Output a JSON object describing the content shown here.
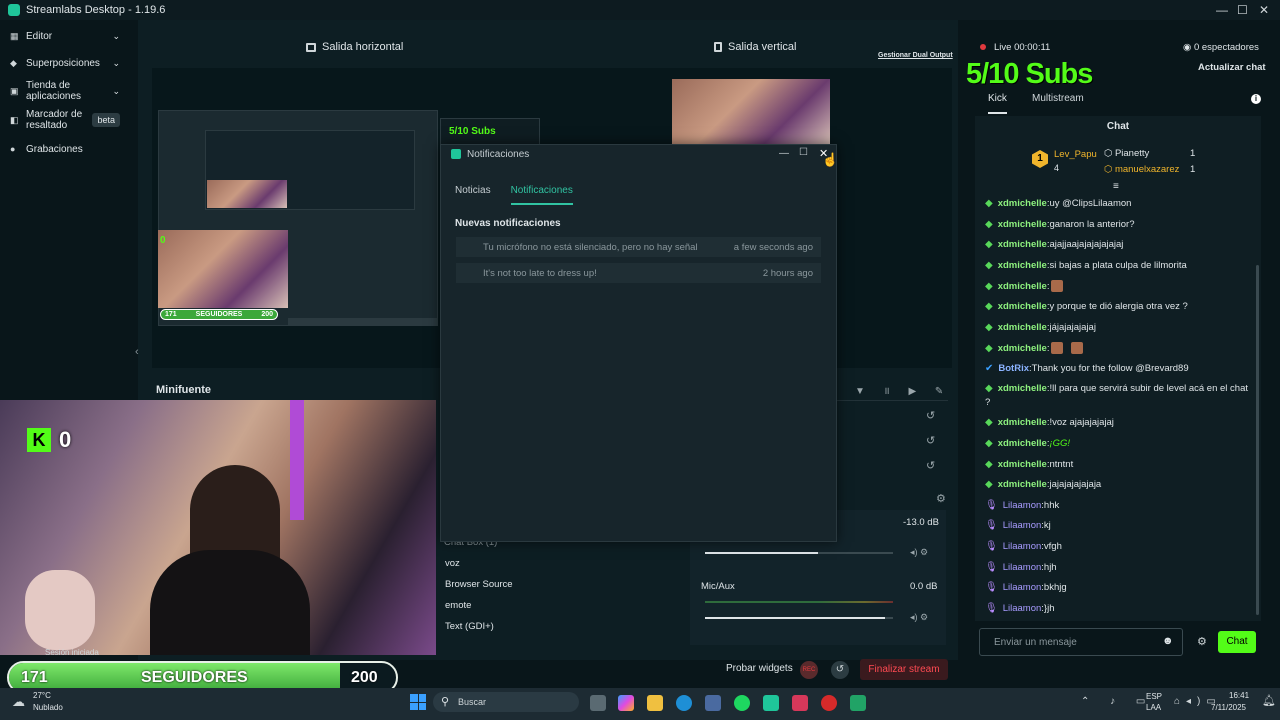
{
  "app": {
    "title": "Streamlabs Desktop - 1.19.6"
  },
  "sidebar": {
    "items": [
      {
        "label": "Editor",
        "icon": "layout-icon",
        "chevron": "chevron-down-icon"
      },
      {
        "label": "Superposiciones",
        "icon": "palette-icon",
        "chevron": "chevron-down-icon"
      },
      {
        "label": "Tienda de aplicaciones",
        "icon": "store-icon",
        "chevron": "chevron-down-icon"
      },
      {
        "label": "Marcador de resaltado",
        "icon": "bookmark-icon",
        "badge": "beta"
      },
      {
        "label": "Grabaciones",
        "icon": "record-icon"
      }
    ]
  },
  "outputs": {
    "horizontal": "Salida horizontal",
    "vertical": "Salida vertical",
    "manage": "Gestionar Dual Output"
  },
  "preview": {
    "inner_subs": "5/10 Subs",
    "inner_kick": "0",
    "inner_follow_left": "171",
    "inner_follow_mid": "SEGUIDORES",
    "inner_follow_right": "200"
  },
  "notifications": {
    "window_title": "Notificaciones",
    "tabs": [
      {
        "label": "Noticias",
        "active": false
      },
      {
        "label": "Notificaciones",
        "active": true
      }
    ],
    "section": "Nuevas notificaciones",
    "items": [
      {
        "text": "Tu micrófono no está silenciado, pero no hay señal",
        "time": "a few seconds ago"
      },
      {
        "text": "It's not too late to dress up!",
        "time": "2 hours ago"
      }
    ]
  },
  "sources": {
    "title": "Minifuente",
    "items": [
      "Chat Box (1)",
      "voz",
      "Browser Source",
      "emote",
      "Text (GDI+)"
    ]
  },
  "mixer": {
    "channels": [
      {
        "name": "",
        "db": "-13.0 dB",
        "level": 0.6
      },
      {
        "name": "Mic/Aux",
        "db": "0.0 dB",
        "level": 0.96
      }
    ]
  },
  "overlay": {
    "kick_count": "0",
    "follow_current": "171",
    "follow_label": "SEGUIDORES",
    "follow_goal": "200",
    "follow_progress": 0.855,
    "session": "Sesión iniciada"
  },
  "bottombar": {
    "test_widgets": "Probar widgets",
    "end_stream": "Finalizar stream",
    "rec": "REC"
  },
  "chat": {
    "live": "Live 00:00:11",
    "viewers": "0 espectadores",
    "refresh": "Actualizar chat",
    "subs_goal": "5/10 Subs",
    "tabs": [
      "Kick",
      "Multistream"
    ],
    "header": "Chat",
    "leaderboard": [
      {
        "rank": "1",
        "name": "Lev_Papu",
        "count": "4"
      },
      {
        "name": "Pianetty",
        "count": "1"
      },
      {
        "name": "manuelxazarez",
        "count": "1"
      }
    ],
    "messages": [
      {
        "user": "xdmichelle",
        "text": "uy @ClipsLilaamon",
        "type": "green"
      },
      {
        "user": "xdmichelle",
        "text": "ganaron la anterior?",
        "type": "green"
      },
      {
        "user": "xdmichelle",
        "text": "ajajjaajajajajajajaj",
        "type": "green"
      },
      {
        "user": "xdmichelle",
        "text": "si bajas a plata culpa de lilmorita",
        "type": "green"
      },
      {
        "user": "xdmichelle",
        "text": "",
        "type": "green",
        "emote": true
      },
      {
        "user": "xdmichelle",
        "text": "y porque te dió alergia otra vez ?",
        "type": "green"
      },
      {
        "user": "xdmichelle",
        "text": "jájajajajajaj",
        "type": "green"
      },
      {
        "user": "xdmichelle",
        "text": "",
        "type": "green",
        "emote": true,
        "emote2": true
      },
      {
        "user": "BotRix",
        "text": "Thank you for the follow @Brevard89",
        "type": "bot"
      },
      {
        "user": "xdmichelle",
        "text": "!ll para que servirá subir de level acá en el chat",
        "type": "green"
      },
      {
        "user": "",
        "text": "?",
        "type": "cont"
      },
      {
        "user": "xdmichelle",
        "text": "!voz ajajajajajaj",
        "type": "green"
      },
      {
        "user": "xdmichelle",
        "text": "¡GG!",
        "type": "green"
      },
      {
        "user": "xdmichelle",
        "text": "ntntnt",
        "type": "green"
      },
      {
        "user": "xdmichelle",
        "text": "jajajajajajaja",
        "type": "green"
      },
      {
        "user": "Lilaamon",
        "text": "hhk",
        "type": "purple"
      },
      {
        "user": "Lilaamon",
        "text": "kj",
        "type": "purple"
      },
      {
        "user": "Lilaamon",
        "text": "vfgh",
        "type": "purple"
      },
      {
        "user": "Lilaamon",
        "text": "hjh",
        "type": "purple"
      },
      {
        "user": "Lilaamon",
        "text": "bkhjg",
        "type": "purple"
      },
      {
        "user": "Lilaamon",
        "text": "}jh",
        "type": "purple"
      }
    ],
    "input_placeholder": "Enviar un mensaje",
    "send": "Chat"
  },
  "taskbar": {
    "weather_temp": "27°C",
    "weather_desc": "Nublado",
    "search": "Buscar",
    "lang1": "ESP",
    "lang2": "LAA",
    "time": "16:41",
    "date": "7/11/2025"
  },
  "colors": {
    "accent": "#31c3a2",
    "kick_green": "#53fc18",
    "danger": "#e0393e"
  }
}
